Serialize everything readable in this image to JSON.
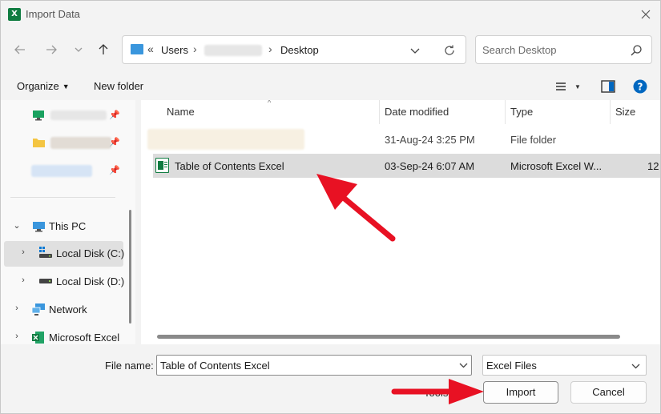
{
  "window": {
    "title": "Import Data",
    "app_icon_letter": "X"
  },
  "nav": {
    "breadcrumb": {
      "prefix": "«",
      "items": [
        "Users",
        "Desktop"
      ]
    }
  },
  "search": {
    "placeholder": "Search Desktop"
  },
  "commands": {
    "organize": "Organize",
    "new_folder": "New folder"
  },
  "sidebar": {
    "this_pc": "This PC",
    "local_disk_c": "Local Disk (C:)",
    "local_disk_d": "Local Disk (D:)",
    "network": "Network",
    "microsoft_excel": "Microsoft Excel"
  },
  "columns": {
    "name": "Name",
    "date_modified": "Date modified",
    "type": "Type",
    "size": "Size"
  },
  "files": [
    {
      "name": "",
      "date_modified": "31-Aug-24 3:25 PM",
      "type": "File folder",
      "size": ""
    },
    {
      "name": "Table of Contents Excel",
      "date_modified": "03-Sep-24 6:07 AM",
      "type": "Microsoft Excel W...",
      "size": "12"
    }
  ],
  "footer": {
    "file_name_label": "File name:",
    "file_name_value": "Table of Contents Excel",
    "file_type": "Excel Files",
    "tools": "Tools",
    "import": "Import",
    "cancel": "Cancel"
  },
  "colors": {
    "excel_green": "#107c41",
    "accent_blue": "#0067c0",
    "selection": "#dcdcdc",
    "annotation_red": "#e81123"
  }
}
